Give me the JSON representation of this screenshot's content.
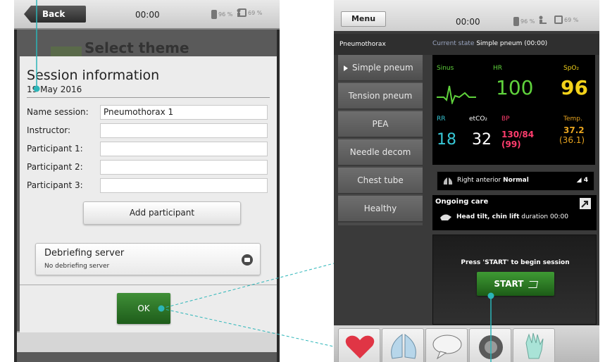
{
  "left_screen": {
    "status": {
      "back_label": "Back",
      "time": "00:00",
      "battery1": "96 %",
      "battery2": "69 %"
    },
    "background": {
      "title": "Select theme"
    },
    "dialog": {
      "title": "Session information",
      "date": "19 May 2016",
      "fields": [
        {
          "label": "Name session:",
          "value": "Pneumothorax 1"
        },
        {
          "label": "Instructor:",
          "value": ""
        },
        {
          "label": "Participant 1:",
          "value": ""
        },
        {
          "label": "Participant 2:",
          "value": ""
        },
        {
          "label": "Participant 3:",
          "value": ""
        }
      ],
      "add_participant_label": "Add participant",
      "debrief": {
        "title": "Debriefing server",
        "subtitle": "No debriefing server"
      },
      "ok_label": "OK"
    }
  },
  "right_screen": {
    "status": {
      "menu_label": "Menu",
      "time": "00:00",
      "battery1": "96 %",
      "battery2": "69 %"
    },
    "case_title": "Pneumothorax",
    "current_state_label": "Current state",
    "current_state_value": "Simple pneum (00:00)",
    "scenarios": [
      {
        "label": "Simple pneum"
      },
      {
        "label": "Tension pneum"
      },
      {
        "label": "PEA"
      },
      {
        "label": "Needle decom"
      },
      {
        "label": "Chest tube"
      },
      {
        "label": "Healthy"
      }
    ],
    "vitals": {
      "rhythm_label": "Sinus",
      "hr_label": "HR",
      "hr_value": "100",
      "spo2_label": "SpO₂",
      "spo2_value": "96",
      "rr_label": "RR",
      "rr_value": "18",
      "etco2_label": "etCO₂",
      "etco2_value": "32",
      "bp_label": "BP",
      "bp_value": "130/84",
      "bp_mean": "(99)",
      "temp_label": "Temp.",
      "temp_value": "37.2",
      "temp_sub": "(36.1)",
      "colors": {
        "green": "#5fd13c",
        "yellow": "#f3d21a",
        "cyan": "#37c7d6",
        "white": "#ffffff",
        "pink": "#ff3d6e",
        "orange": "#e7a41f"
      }
    },
    "respiration": {
      "location": "Right anterior",
      "state": "Normal",
      "value": "4"
    },
    "care": {
      "title": "Ongoing care",
      "action": "Head tilt, chin lift",
      "duration": "duration 00:00"
    },
    "start": {
      "prompt": "Press 'START' to begin session",
      "button_label": "START"
    },
    "tabs": [
      {
        "icon": "heart-icon"
      },
      {
        "icon": "lungs-icon"
      },
      {
        "icon": "speech-bubble-icon"
      },
      {
        "icon": "sound-icon"
      },
      {
        "icon": "glove-icon"
      }
    ]
  },
  "accent": "#2bb5b8"
}
